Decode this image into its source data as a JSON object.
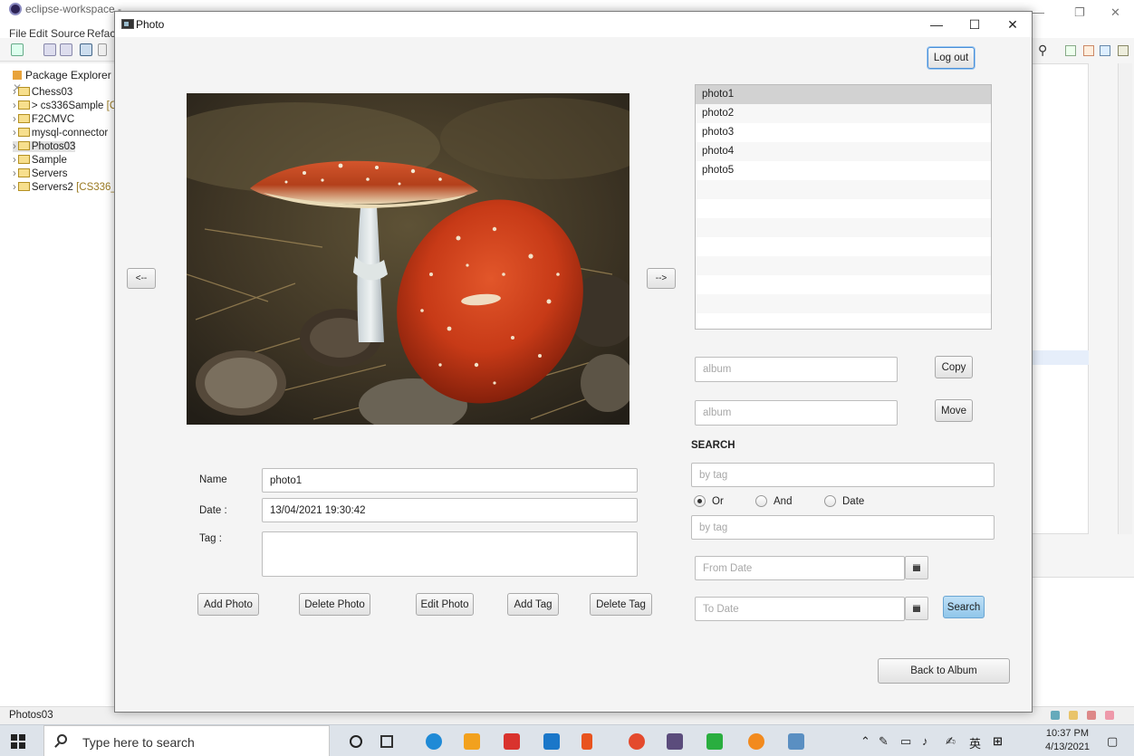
{
  "eclipse": {
    "window_title": "eclipse-workspace -",
    "menu": [
      "File",
      "Edit",
      "Source",
      "Refac"
    ],
    "package_explorer": {
      "title": "Package Explorer",
      "title_mark": "✕",
      "items": [
        {
          "label": "Chess03",
          "extra": ""
        },
        {
          "label": "> cs336Sample",
          "extra": "[C"
        },
        {
          "label": "F2CMVC",
          "extra": ""
        },
        {
          "label": "mysql-connector",
          "extra": ""
        },
        {
          "label": "Photos03",
          "extra": ""
        },
        {
          "label": "Sample",
          "extra": ""
        },
        {
          "label": "Servers",
          "extra": ""
        },
        {
          "label": "Servers2",
          "extra": "[CS336_"
        }
      ]
    },
    "status_text": "Photos03"
  },
  "dialog": {
    "title": "Photo",
    "controls": {
      "minimize": "—",
      "maximize": "☐",
      "close": "✕"
    },
    "logout_label": "Log out",
    "prev_label": "<--",
    "next_label": "-->",
    "photo_list": [
      "photo1",
      "photo2",
      "photo3",
      "photo4",
      "photo5",
      "",
      "",
      "",
      "",
      "",
      "",
      "",
      ""
    ],
    "selected_photo_index": 0,
    "copy": {
      "placeholder": "album",
      "button": "Copy"
    },
    "move": {
      "placeholder": "album",
      "button": "Move"
    },
    "search": {
      "heading": "SEARCH",
      "tag1_placeholder": "by tag",
      "tag2_placeholder": "by tag",
      "mode_options": [
        "Or",
        "And",
        "Date"
      ],
      "selected_mode": "Or",
      "from_date_placeholder": "From Date",
      "to_date_placeholder": "To Date",
      "button": "Search"
    },
    "details": {
      "name_label": "Name",
      "name_value": "photo1",
      "date_label": "Date :",
      "date_value": "13/04/2021 19:30:42",
      "tag_label": "Tag :",
      "tag_value": ""
    },
    "actions": [
      "Add Photo",
      "Delete Photo",
      "Edit Photo",
      "Add Tag",
      "Delete Tag"
    ],
    "back_label": "Back to Album"
  },
  "taskbar": {
    "search_placeholder": "Type here to search",
    "ime": "英",
    "time": "10:37 PM",
    "date": "4/13/2021"
  },
  "colors": {
    "selection": "#d2d2d2",
    "focus_border": "#4a8fd8",
    "search_button": "#9fcdee"
  }
}
